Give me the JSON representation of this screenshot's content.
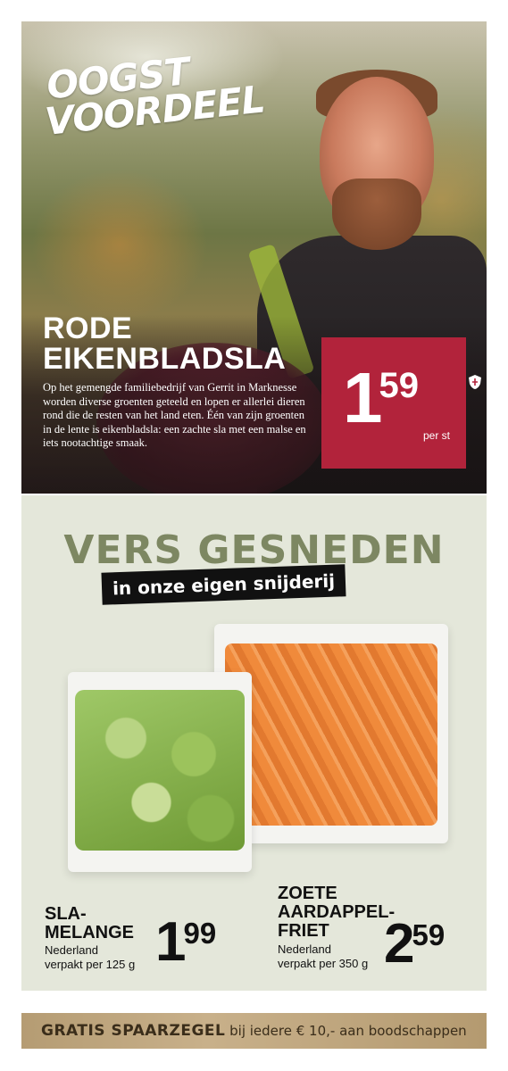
{
  "hero": {
    "brand_line1": "OOGST",
    "brand_line2": "VOORDEEL",
    "product_line1": "RODE",
    "product_line2": "EIKENBLADSLA",
    "description": "Op het gemengde familiebedrijf van Gerrit in Marknesse worden diverse groenten geteeld en lopen er allerlei dieren rond die de resten van het land eten. Één van zijn groenten in de lente is eikenbladsla: een zachte sla met een malse en iets nootachtige smaak.",
    "price_euros": "1",
    "price_cents": "59",
    "price_unit": "per st",
    "emblem_icon": "shield-emblem",
    "price_color": "#b2233b"
  },
  "fresh": {
    "title": "VERS GESNEDEN",
    "banner": "in onze eigen snijderij",
    "title_color": "#7d8762",
    "items": [
      {
        "name_line1": "SLA-",
        "name_line2": "MELANGE",
        "origin": "Nederland",
        "pack": "verpakt per 125 g",
        "price_euros": "1",
        "price_cents": "99"
      },
      {
        "name_line1": "ZOETE",
        "name_line2": "AARDAPPEL-",
        "name_line3": "FRIET",
        "origin": "Nederland",
        "pack": "verpakt per 350 g",
        "price_euros": "2",
        "price_cents": "59"
      }
    ]
  },
  "stamp": {
    "strong": "GRATIS SPAARZEGEL",
    "rest": " bij iedere € 10,- aan boodschappen"
  }
}
